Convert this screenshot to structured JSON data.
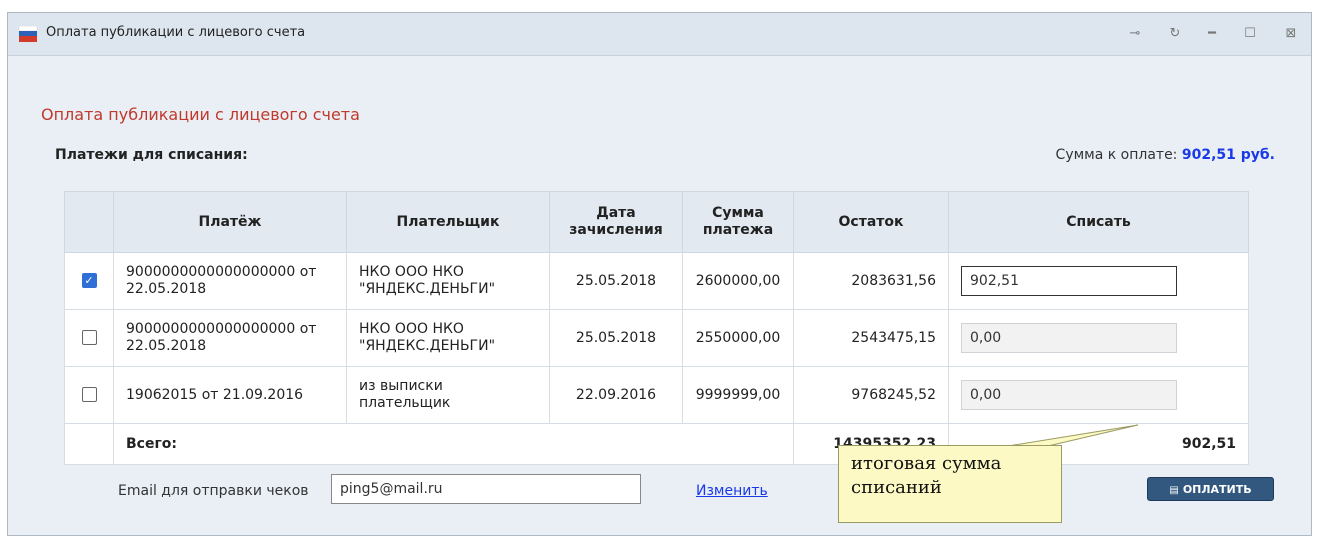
{
  "window": {
    "title": "Оплата публикации с лицевого счета",
    "controls": [
      "pin-icon",
      "refresh-icon",
      "minimize-icon",
      "maximize-icon",
      "close-icon"
    ]
  },
  "page": {
    "heading": "Оплата публикации с лицевого счета",
    "payments_label": "Платежи для списания:",
    "sum_label": "Сумма к оплате:",
    "sum_value": "902,51 руб."
  },
  "table": {
    "headers": {
      "payment": "Платёж",
      "payer": "Плательщик",
      "date_line1": "Дата",
      "date_line2": "зачисления",
      "amount_line1": "Сумма",
      "amount_line2": "платежа",
      "remainder": "Остаток",
      "writeoff": "Списать"
    },
    "rows": [
      {
        "checked": true,
        "payment_line1": "9000000000000000000 от",
        "payment_line2": "22.05.2018",
        "payer_line1": "НКО ООО НКО",
        "payer_line2": "\"ЯНДЕКС.ДЕНЬГИ\"",
        "date": "25.05.2018",
        "amount": "2600000,00",
        "remainder": "2083631,56",
        "writeoff": "902,51"
      },
      {
        "checked": false,
        "payment_line1": "9000000000000000000 от",
        "payment_line2": "22.05.2018",
        "payer_line1": "НКО ООО НКО",
        "payer_line2": "\"ЯНДЕКС.ДЕНЬГИ\"",
        "date": "25.05.2018",
        "amount": "2550000,00",
        "remainder": "2543475,15",
        "writeoff": "0,00"
      },
      {
        "checked": false,
        "payment_line1": "19062015 от 21.09.2016",
        "payment_line2": "",
        "payer_line1": "из выписки",
        "payer_line2": "плательщик",
        "date": "22.09.2016",
        "amount": "9999999,00",
        "remainder": "9768245,52",
        "writeoff": "0,00"
      }
    ],
    "total_label": "Всего:",
    "total_remainder": "14395352,23",
    "total_writeoff": "902,51"
  },
  "footer": {
    "email_label": "Email для отправки чеков",
    "email_value": "ping5@mail.ru",
    "change_link": "Изменить",
    "pay_button": "ОПЛАТИТЬ"
  },
  "callout": {
    "line1": "итоговая сумма",
    "line2": "списаний"
  }
}
